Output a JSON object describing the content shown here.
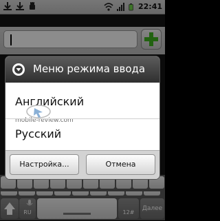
{
  "status_bar": {
    "time": "22:41",
    "icons_left": [
      "download-icon",
      "download-icon",
      "usb-debug-icon"
    ],
    "icons_right": [
      "wifi-icon",
      "signal-icon",
      "battery-icon"
    ]
  },
  "app": {
    "add_button_icon": "plus-icon"
  },
  "dialog": {
    "title": "Меню режима ввода",
    "options": [
      "Английский",
      "Русский"
    ],
    "settings_button": "Настройка...",
    "cancel_button": "Отмена",
    "watermark": "mobile-review.com"
  },
  "keyboard": {
    "lang_key": "RU",
    "number_key": "12#",
    "next_key": "Далее"
  },
  "colors": {
    "add_button_green": "#3fb31f",
    "dialog_title_bg": "#3a3a3a",
    "battery_green": "#6fd24a"
  }
}
